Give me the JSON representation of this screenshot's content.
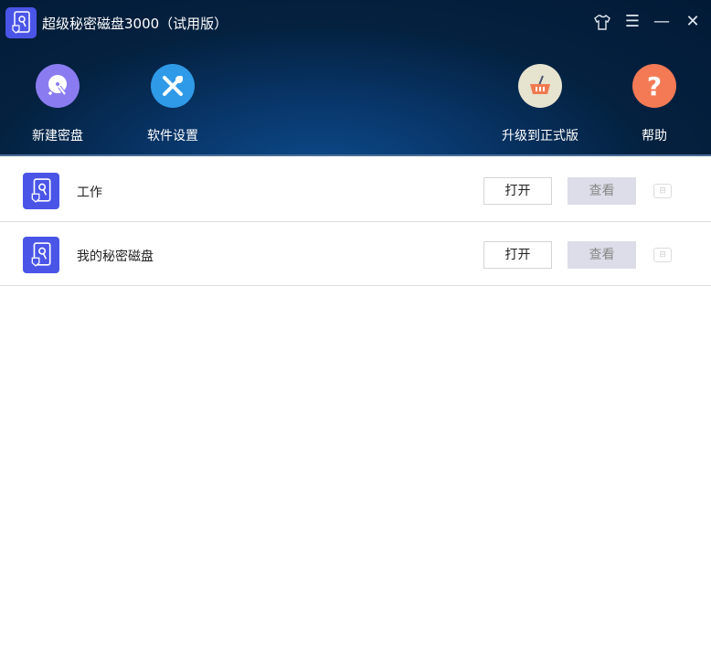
{
  "app": {
    "title": "超级秘密磁盘3000（试用版）"
  },
  "toolbar": [
    {
      "label": "新建密盘",
      "icon": "new-disk-icon",
      "color": "#8a7cf0"
    },
    {
      "label": "软件设置",
      "icon": "settings-icon",
      "color": "#2f9ae8"
    },
    {
      "label": "升级到正式版",
      "icon": "basket-icon",
      "color": "#e6e3cf"
    },
    {
      "label": "帮助",
      "icon": "help-icon",
      "color": "#f37a55",
      "glyph": "?"
    }
  ],
  "disks": [
    {
      "name": "工作",
      "open": "打开",
      "view": "查看"
    },
    {
      "name": "我的秘密磁盘",
      "open": "打开",
      "view": "查看"
    }
  ]
}
